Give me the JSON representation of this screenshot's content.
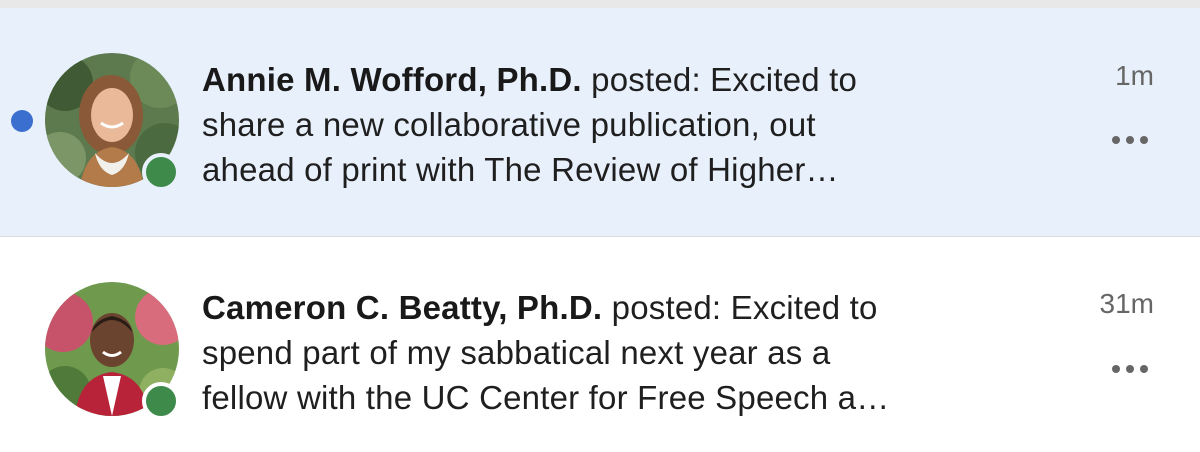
{
  "notifications": [
    {
      "name": "Annie M. Wofford, Ph.D.",
      "action": " posted: Excited to",
      "line2": "share a new collaborative publication, out",
      "line3": "ahead of print with The Review of Higher…",
      "time": "1m",
      "unread": true,
      "online": true
    },
    {
      "name": "Cameron C. Beatty, Ph.D.",
      "action": " posted: Excited to",
      "line2": "spend part of my sabbatical next year as a",
      "line3": "fellow with the UC Center for Free Speech a…",
      "time": "31m",
      "unread": false,
      "online": true
    }
  ],
  "icons": {
    "unread": "unread-dot-icon",
    "presence": "online-status-icon",
    "more": "more-options-icon"
  },
  "colors": {
    "unread_background": "#e8f0fb",
    "unread_dot": "#3a6fd0",
    "presence_online": "#3d8a4a"
  }
}
